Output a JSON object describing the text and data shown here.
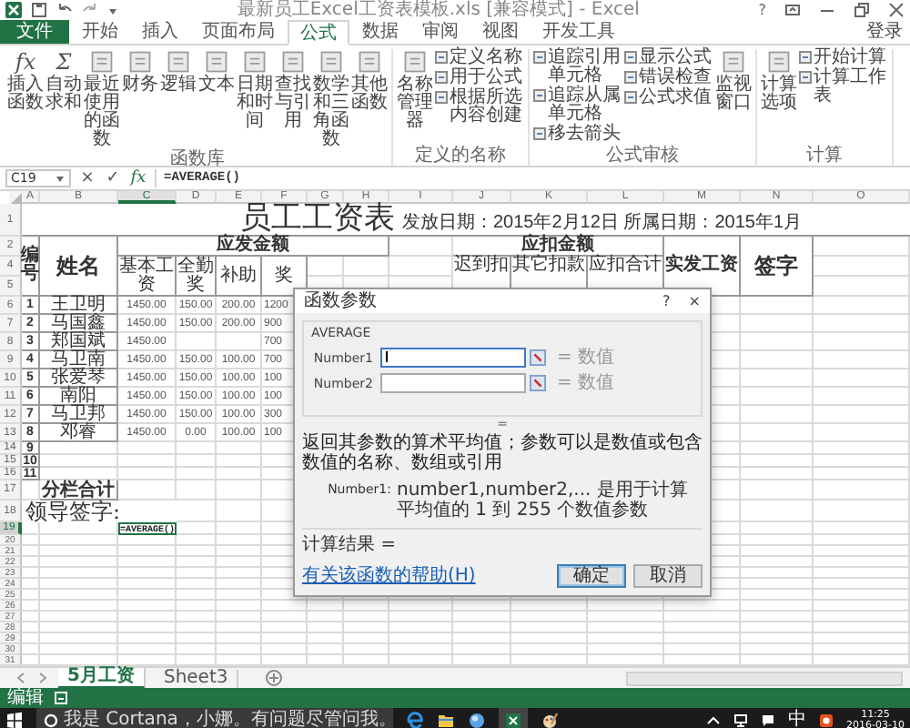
{
  "window": {
    "title": "最新员工Excel工资表模板.xls [兼容模式] - Excel",
    "help": "?"
  },
  "ribbon_tabs": [
    {
      "label": "文件",
      "kind": "file",
      "selected": false
    },
    {
      "label": "开始",
      "kind": "tab",
      "selected": false
    },
    {
      "label": "插入",
      "kind": "tab",
      "selected": false
    },
    {
      "label": "页面布局",
      "kind": "tab",
      "selected": false
    },
    {
      "label": "公式",
      "kind": "tab",
      "selected": true
    },
    {
      "label": "数据",
      "kind": "tab",
      "selected": false
    },
    {
      "label": "审阅",
      "kind": "tab",
      "selected": false
    },
    {
      "label": "视图",
      "kind": "tab",
      "selected": false
    },
    {
      "label": "开发工具",
      "kind": "tab",
      "selected": false
    }
  ],
  "account": "登录",
  "ribbon_groups": [
    {
      "label": "函数库",
      "items": [
        {
          "kind": "large",
          "label": "插入函数",
          "glyph": "fx"
        },
        {
          "kind": "large",
          "label": "自动求和",
          "glyph": "Σ"
        },
        {
          "kind": "large",
          "label": "最近使用的函数"
        },
        {
          "kind": "large",
          "label": "财务"
        },
        {
          "kind": "large",
          "label": "逻辑"
        },
        {
          "kind": "large",
          "label": "文本"
        },
        {
          "kind": "large",
          "label": "日期和时间"
        },
        {
          "kind": "large",
          "label": "查找与引用"
        },
        {
          "kind": "large",
          "label": "数学和三角函数"
        },
        {
          "kind": "large",
          "label": "其他函数"
        }
      ]
    },
    {
      "label": "定义的名称",
      "items": [
        {
          "kind": "large",
          "label": "名称管理器"
        },
        {
          "kind": "stack",
          "items": [
            "定义名称",
            "用于公式",
            "根据所选内容创建"
          ]
        }
      ]
    },
    {
      "label": "公式审核",
      "items": [
        {
          "kind": "stack",
          "items": [
            "追踪引用单元格",
            "追踪从属单元格",
            "移去箭头"
          ]
        },
        {
          "kind": "stack",
          "items": [
            "显示公式",
            "错误检查",
            "公式求值"
          ]
        },
        {
          "kind": "large",
          "label": "监视窗口"
        }
      ]
    },
    {
      "label": "计算",
      "items": [
        {
          "kind": "large",
          "label": "计算选项"
        },
        {
          "kind": "stack",
          "items": [
            "开始计算",
            "计算工作表"
          ]
        }
      ]
    }
  ],
  "formula_bar": {
    "name_box": "C19",
    "cancel": "×",
    "enter": "✓",
    "fx": "fx",
    "formula": "=AVERAGE()"
  },
  "columns": [
    {
      "label": "A",
      "selected": false
    },
    {
      "label": "B",
      "selected": false
    },
    {
      "label": "C",
      "selected": true
    },
    {
      "label": "D",
      "selected": false
    },
    {
      "label": "E",
      "selected": false
    },
    {
      "label": "F",
      "selected": false
    },
    {
      "label": "G",
      "selected": false
    },
    {
      "label": "H",
      "selected": false
    },
    {
      "label": "I",
      "selected": false
    },
    {
      "label": "J",
      "selected": false
    },
    {
      "label": "K",
      "selected": false
    },
    {
      "label": "L",
      "selected": false
    },
    {
      "label": "M",
      "selected": false
    },
    {
      "label": "N",
      "selected": false
    },
    {
      "label": "O",
      "selected": false
    }
  ],
  "sheet": {
    "rows": [
      {
        "kind": "title",
        "num": "1",
        "selected": false,
        "title": "员工工资表",
        "date_line": "发放日期：2015年2月12日 所属日期：2015年1月"
      },
      {
        "kind": "group_header",
        "num": "2",
        "selected": false,
        "no_label": "编号",
        "name_label": "姓名",
        "paid_label": "应发金额",
        "deduct_label": "应扣金额",
        "net_label": "实发工资",
        "sign_label": "签字"
      },
      {
        "kind": "sub_header",
        "num": "4",
        "selected": false,
        "paid_items": [
          "基本工资",
          "全勤奖",
          "补助",
          "奖"
        ],
        "deduct_items": [
          "迟到扣",
          "其它扣款",
          "应扣合计"
        ]
      },
      {
        "kind": "sub_header2",
        "num": "5",
        "selected": false
      },
      {
        "kind": "data",
        "num": "6",
        "selected": false,
        "no": "1",
        "name": "王卫明",
        "values": {
          "basic_pay": "1450.00",
          "attendance_bonus": "150.00",
          "allowance": "200.00",
          "column_f": "1200"
        }
      },
      {
        "kind": "data",
        "num": "7",
        "selected": false,
        "no": "2",
        "name": "马国鑫",
        "values": {
          "basic_pay": "1450.00",
          "attendance_bonus": "150.00",
          "allowance": "200.00",
          "column_f": "900"
        }
      },
      {
        "kind": "data",
        "num": "8",
        "selected": false,
        "no": "3",
        "name": "郑国斌",
        "values": {
          "basic_pay": "1450.00",
          "column_f": "700"
        }
      },
      {
        "kind": "data",
        "num": "9",
        "selected": false,
        "no": "4",
        "name": "马卫南",
        "values": {
          "basic_pay": "1450.00",
          "attendance_bonus": "150.00",
          "allowance": "100.00",
          "column_f": "700"
        }
      },
      {
        "kind": "data",
        "num": "10",
        "selected": false,
        "no": "5",
        "name": "张爱琴",
        "values": {
          "basic_pay": "1450.00",
          "attendance_bonus": "150.00",
          "allowance": "100.00",
          "column_f": "100"
        }
      },
      {
        "kind": "data",
        "num": "11",
        "selected": false,
        "no": "6",
        "name": "南阳",
        "values": {
          "basic_pay": "1450.00",
          "attendance_bonus": "150.00",
          "allowance": "100.00",
          "column_f": "100"
        }
      },
      {
        "kind": "data",
        "num": "12",
        "selected": false,
        "no": "7",
        "name": "马卫邦",
        "values": {
          "basic_pay": "1450.00",
          "attendance_bonus": "150.00",
          "allowance": "100.00",
          "column_f": "300"
        }
      },
      {
        "kind": "data",
        "num": "13",
        "selected": false,
        "no": "8",
        "name": "邓睿",
        "values": {
          "basic_pay": "1450.00",
          "attendance_bonus": "0.00",
          "allowance": "100.00",
          "column_f": "100"
        }
      },
      {
        "kind": "data",
        "num": "14",
        "selected": false,
        "no": "9"
      },
      {
        "kind": "data",
        "num": "15",
        "selected": false,
        "no": "10"
      },
      {
        "kind": "data",
        "num": "16",
        "selected": false,
        "no": "11"
      },
      {
        "kind": "total",
        "num": "17",
        "selected": false,
        "label": "分栏合计"
      },
      {
        "kind": "sign",
        "num": "18",
        "selected": false,
        "label": "领导签字:"
      },
      {
        "kind": "formula",
        "num": "19",
        "selected": true,
        "cell": "=AVERAGE()"
      },
      {
        "kind": "blank",
        "num": "20",
        "selected": false
      },
      {
        "kind": "blank",
        "num": "21",
        "selected": false
      },
      {
        "kind": "blank",
        "num": "22",
        "selected": false
      },
      {
        "kind": "blank",
        "num": "23",
        "selected": false
      },
      {
        "kind": "blank",
        "num": "24",
        "selected": false
      },
      {
        "kind": "blank",
        "num": "25",
        "selected": false
      },
      {
        "kind": "blank",
        "num": "26",
        "selected": false
      },
      {
        "kind": "blank",
        "num": "27",
        "selected": false
      },
      {
        "kind": "blank",
        "num": "28",
        "selected": false
      },
      {
        "kind": "blank",
        "num": "29",
        "selected": false
      },
      {
        "kind": "blank",
        "num": "30",
        "selected": false
      },
      {
        "kind": "blank",
        "num": "31",
        "selected": false
      }
    ]
  },
  "dialog": {
    "title": "函数参数",
    "help": "?",
    "close": "×",
    "function": "AVERAGE",
    "args": [
      {
        "label": "Number1",
        "focused": true,
        "result": "= 数值"
      },
      {
        "label": "Number2",
        "focused": false,
        "result": "= 数值"
      }
    ],
    "result_mark": "=",
    "description": "返回其参数的算术平均值；参数可以是数值或包含数值的名称、数组或引用",
    "arg_help_label": "Number1:",
    "arg_help": "number1,number2,... 是用于计算平均值的 1 到 255 个数值参数",
    "result_label": "计算结果 =",
    "help_link": "有关该函数的帮助(H)",
    "buttons": [
      {
        "label": "确定",
        "kind": "primary"
      },
      {
        "label": "取消",
        "kind": "secondary"
      }
    ]
  },
  "sheet_tabs": [
    {
      "label": "5月工资",
      "selected": true
    },
    {
      "label": "Sheet3",
      "selected": false
    }
  ],
  "status_bar": {
    "mode": "编辑"
  },
  "taskbar": {
    "search_placeholder": "我是 Cortana，小娜。有问题尽管问我。",
    "ime": "中",
    "time": "11:25",
    "date": "2016-03-10"
  }
}
